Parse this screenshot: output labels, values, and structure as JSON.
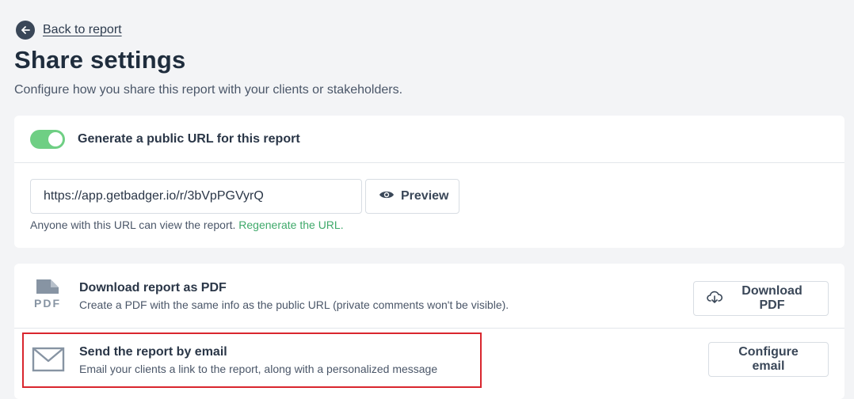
{
  "nav": {
    "back_label": "Back to report"
  },
  "header": {
    "title": "Share settings",
    "subtitle": "Configure how you share this report with your clients or stakeholders."
  },
  "public_url": {
    "toggle_label": "Generate a public URL for this report",
    "toggle_on": true,
    "url_value": "https://app.getbadger.io/r/3bVpPGVyrQ",
    "preview_label": "Preview",
    "note": "Anyone with this URL can view the report.",
    "regenerate_label": "Regenerate the URL."
  },
  "pdf": {
    "icon_text": "PDF",
    "title": "Download report as PDF",
    "description": "Create a PDF with the same info as the public URL (private comments won't be visible).",
    "button_label": "Download PDF"
  },
  "email": {
    "title": "Send the report by email",
    "description": "Email your clients a link to the report, along with a personalized message",
    "button_label": "Configure email"
  },
  "colors": {
    "toggle_on": "#6fcf84",
    "link_green": "#3fa96a",
    "highlight_red": "#d9262e",
    "text_dark": "#1f2d3d"
  }
}
